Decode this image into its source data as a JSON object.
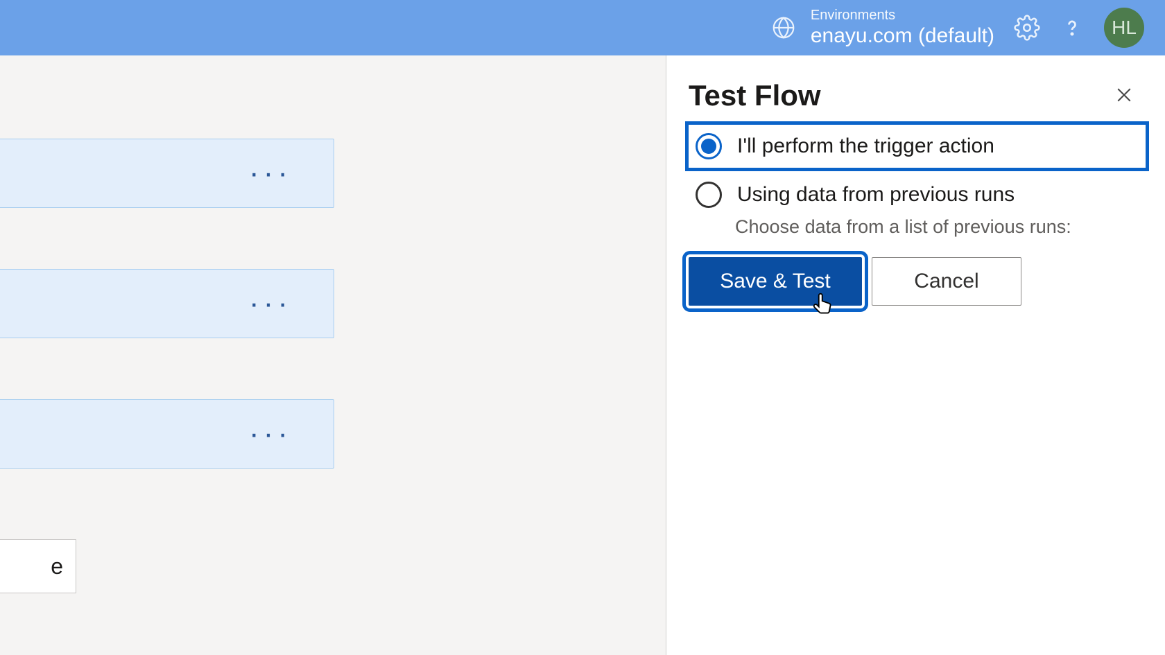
{
  "header": {
    "env_label": "Environments",
    "env_name": "enayu.com (default)",
    "avatar": "HL"
  },
  "canvas": {
    "value_box": "e"
  },
  "panel": {
    "title": "Test Flow",
    "radio_manual": "I'll perform the trigger action",
    "radio_previous": "Using data from previous runs",
    "desc_previous": "Choose data from a list of previous runs:",
    "btn_primary": "Save & Test",
    "btn_cancel": "Cancel"
  }
}
